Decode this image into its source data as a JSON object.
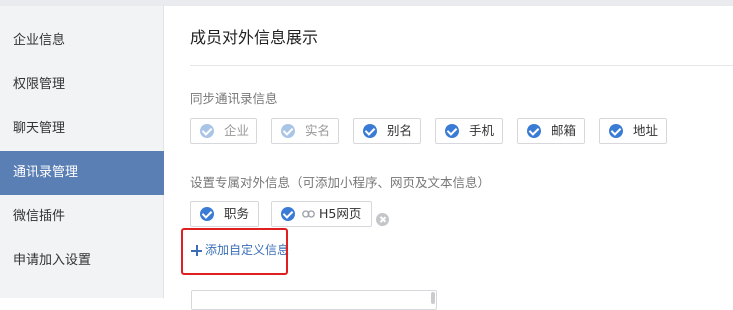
{
  "sidebar": {
    "items": [
      {
        "label": "企业信息",
        "active": false
      },
      {
        "label": "权限管理",
        "active": false
      },
      {
        "label": "聊天管理",
        "active": false
      },
      {
        "label": "通讯录管理",
        "active": true
      },
      {
        "label": "微信插件",
        "active": false
      },
      {
        "label": "申请加入设置",
        "active": false
      }
    ]
  },
  "main": {
    "title": "成员对外信息展示",
    "sync_section": {
      "label": "同步通讯录信息",
      "chips": [
        {
          "label": "企业",
          "checked": true,
          "disabled": true
        },
        {
          "label": "实名",
          "checked": true,
          "disabled": true
        },
        {
          "label": "别名",
          "checked": true,
          "disabled": false
        },
        {
          "label": "手机",
          "checked": true,
          "disabled": false
        },
        {
          "label": "邮箱",
          "checked": true,
          "disabled": false
        },
        {
          "label": "地址",
          "checked": true,
          "disabled": false
        }
      ]
    },
    "custom_section": {
      "label": "设置专属对外信息（可添加小程序、网页及文本信息）",
      "chips": [
        {
          "label": "职务",
          "checked": true,
          "icon": ""
        },
        {
          "label": "H5网页",
          "checked": true,
          "icon": "link-icon",
          "removable": true
        }
      ]
    },
    "add_custom_label": "添加自定义信息"
  },
  "colors": {
    "accent": "#3a7bd5",
    "sidebar_active": "#5a7fb5",
    "highlight": "#e02020",
    "link": "#3a6fb7"
  }
}
